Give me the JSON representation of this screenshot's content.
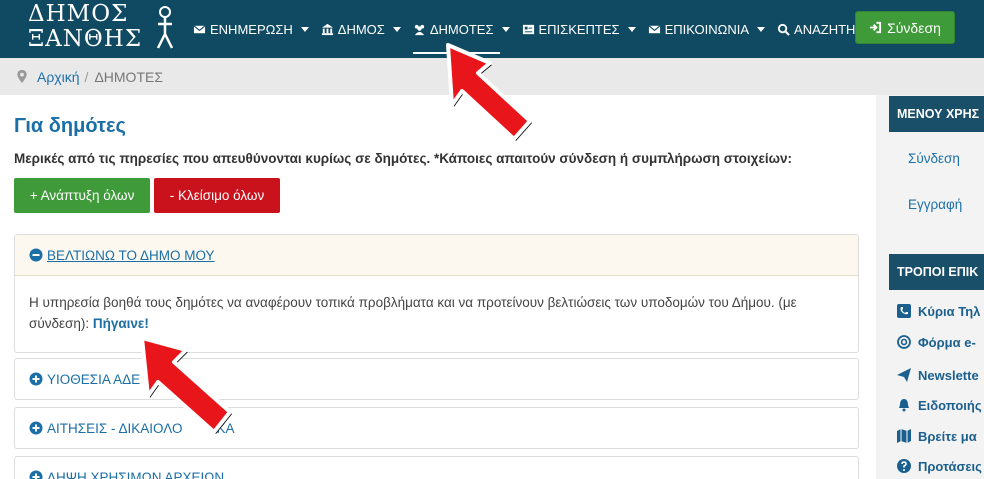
{
  "brand": {
    "logo_line1": "ΔΗΜΟΣ",
    "logo_line2": "ΞΑΝΘΗΣ"
  },
  "nav": {
    "items": [
      {
        "label": "ΕΝΗΜΕΡΩΣΗ",
        "icon": "envelope-icon"
      },
      {
        "label": "ΔΗΜΟΣ",
        "icon": "bank-icon"
      },
      {
        "label": "ΔΗΜΟΤΕΣ",
        "icon": "users-icon",
        "active": true
      },
      {
        "label": "ΕΠΙΣΚΕΠΤΕΣ",
        "icon": "id-card-icon"
      },
      {
        "label": "ΕΠΙΚΟΙΝΩΝΙΑ",
        "icon": "envelope-icon"
      },
      {
        "label": "ΑΝΑΖΗΤΗΣΗ",
        "icon": "search-icon"
      }
    ],
    "login_label": "Σύνδεση"
  },
  "breadcrumb": {
    "home": "Αρχική",
    "separator": "/",
    "current": "ΔΗΜΟΤΕΣ"
  },
  "main": {
    "title": "Για δημότες",
    "intro": "Μερικές από τις πηρεσίες που απευθύνονται κυρίως σε δημότες. *Κάποιες απαιτούν σύνδεση ή συμπλήρωση στοιχείων:",
    "expand_all": "+ Ανάπτυξη όλων",
    "collapse_all": "- Κλείσιμο όλων",
    "panels": [
      {
        "title": "ΒΕΛΤΙΩΝΩ ΤΟ ΔΗΜΟ ΜΟΥ",
        "expanded": true,
        "body": "Η υπηρεσία βοηθά τους δημότες να αναφέρουν τοπικά προβλήματα και να προτείνουν βελτιώσεις των υποδομών του Δήμου. (με σύνδεση):",
        "link": "Πήγαινε!"
      },
      {
        "title": "ΥΙΟΘΕΣΙΑ ΑΔΕ",
        "expanded": false
      },
      {
        "title": "ΑΙΤΗΣΕΙΣ - ΔΙΚΑΙΟΛΟ",
        "title_tail": "ΚΑ",
        "expanded": false
      },
      {
        "title": "ΛΗΨΗ ΧΡΗΣΙΜΩΝ ΑΡΧΕΙΩΝ",
        "expanded": false
      }
    ]
  },
  "sidebar": {
    "menu_heading": "ΜΕΝΟΥ ΧΡΗΣ",
    "menu_links": [
      "Σύνδεση",
      "Εγγραφή"
    ],
    "contact_heading": "ΤΡΟΠΟΙ ΕΠΙΚ",
    "contact_items": [
      {
        "label": "Κύρια Τηλ",
        "icon": "phone-icon"
      },
      {
        "label": "Φόρμα e-",
        "icon": "at-icon"
      },
      {
        "label": "Newslette",
        "icon": "paper-plane-icon"
      },
      {
        "label": "Ειδοποιής",
        "icon": "bell-icon"
      },
      {
        "label": "Βρείτε μα",
        "icon": "map-icon"
      },
      {
        "label": "Προτάσεις",
        "icon": "question-icon"
      }
    ]
  },
  "colors": {
    "navbar": "#0f4a62",
    "accent_blue": "#1b6fa6",
    "green": "#3f9a3a",
    "red": "#c9121b",
    "arrow_red": "#e8161b"
  }
}
